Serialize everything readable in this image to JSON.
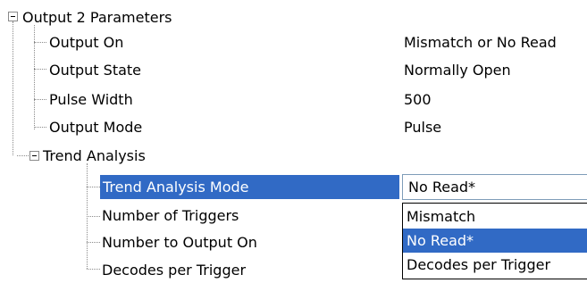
{
  "tree": {
    "root": {
      "label": "Output 2 Parameters"
    },
    "params": [
      {
        "label": "Output On",
        "value": "Mismatch or No Read"
      },
      {
        "label": "Output State",
        "value": "Normally Open"
      },
      {
        "label": "Pulse Width",
        "value": "500"
      },
      {
        "label": "Output Mode",
        "value": "Pulse"
      }
    ],
    "trend": {
      "label": "Trend Analysis",
      "children": [
        {
          "label": "Trend Analysis Mode"
        },
        {
          "label": "Number of Triggers"
        },
        {
          "label": "Number to Output On"
        },
        {
          "label": "Decodes per Trigger"
        }
      ]
    }
  },
  "combo": {
    "value": "No Read*",
    "options": [
      "Mismatch",
      "No Read*",
      "Decodes per Trigger"
    ],
    "selected_index": 1
  },
  "colors": {
    "selection": "#316ac5",
    "tree_line": "#8a8a8a"
  },
  "icons": [
    "collapse-minus-icon"
  ]
}
